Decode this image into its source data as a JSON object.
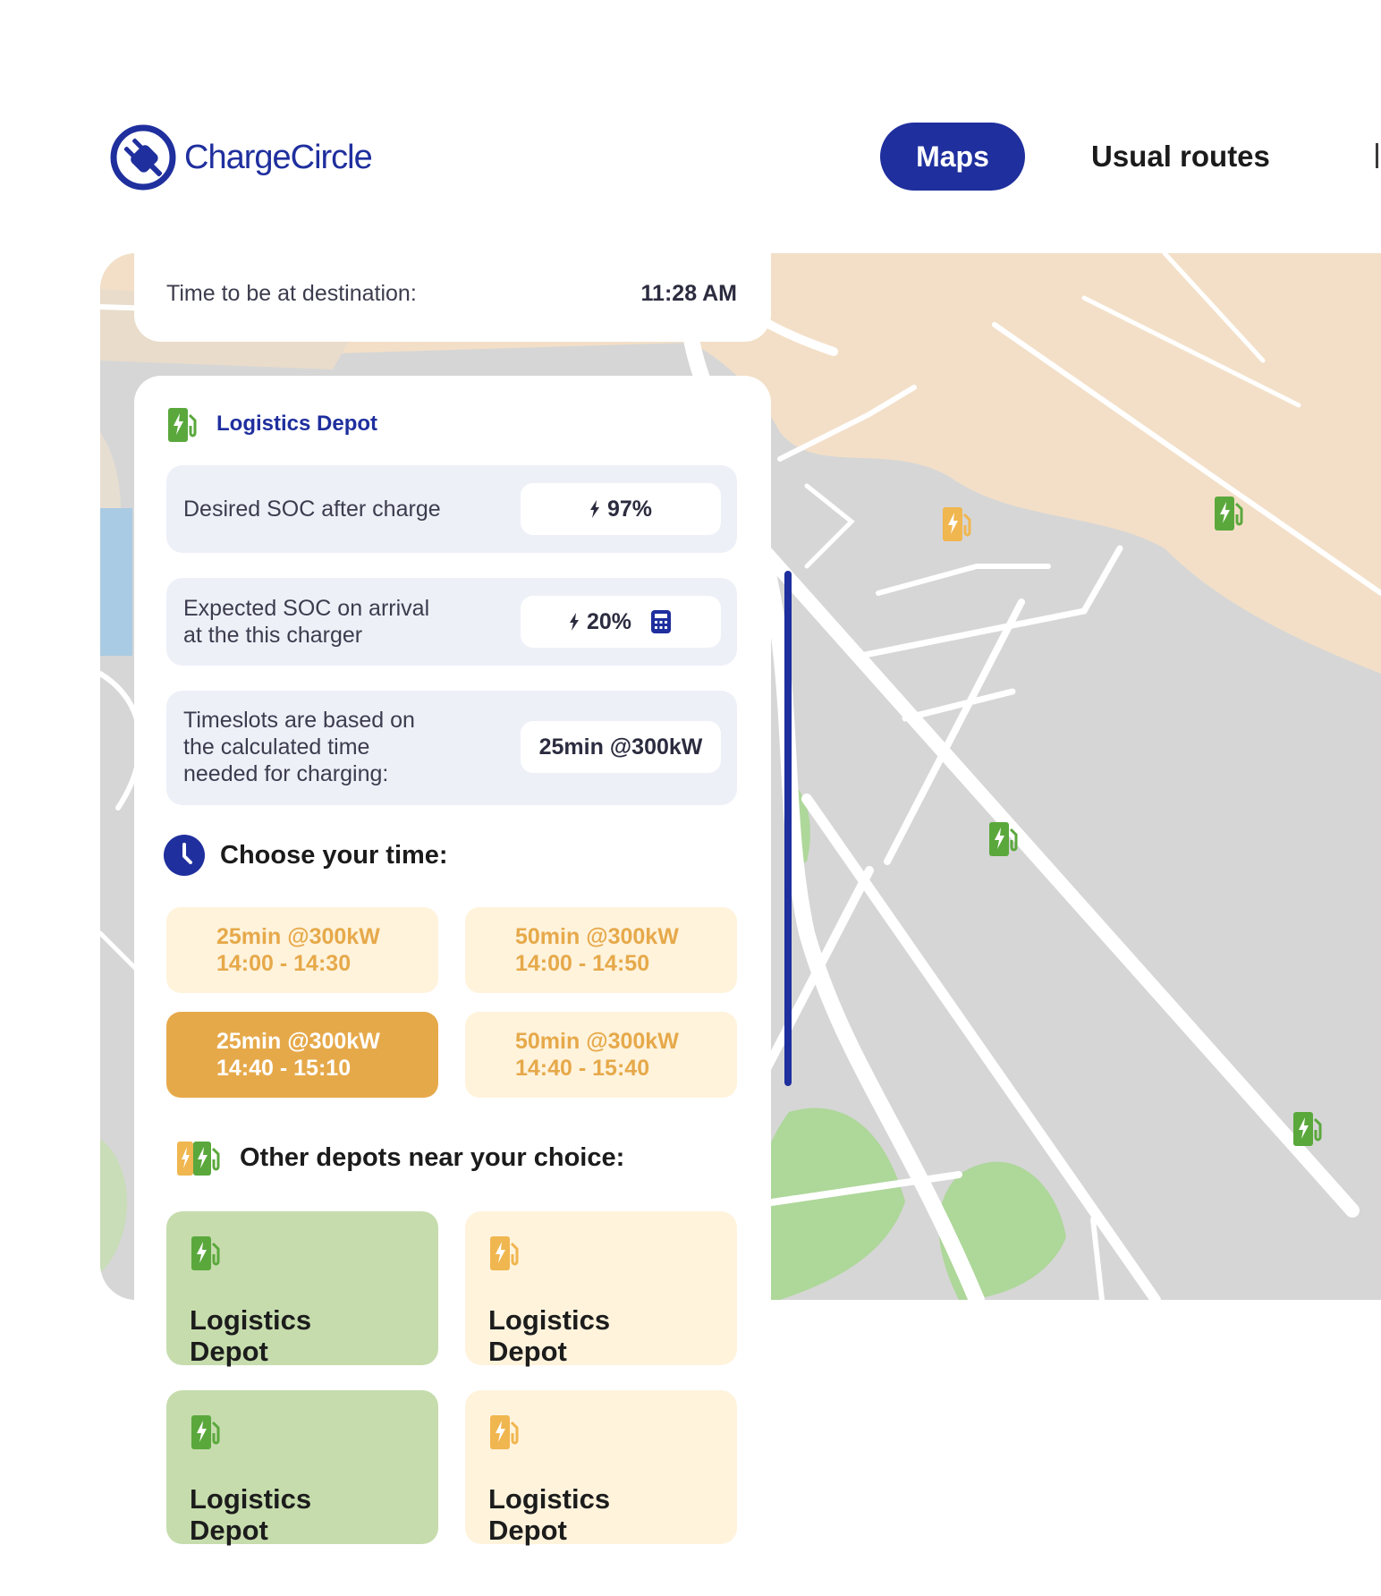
{
  "app": {
    "name": "ChargeCircle"
  },
  "nav": {
    "tabs": [
      {
        "label": "Maps",
        "active": true
      },
      {
        "label": "Usual routes",
        "active": false
      }
    ]
  },
  "destination": {
    "label": "Time to be at destination:",
    "value": "11:28 AM"
  },
  "depot": {
    "name": "Logistics Depot",
    "desired_soc": {
      "label": "Desired SOC after charge",
      "value": "97%"
    },
    "expected_soc": {
      "label_line1": "Expected SOC on arrival",
      "label_line2": "at the this charger",
      "value": "20%"
    },
    "timeslot_basis": {
      "label_line1": "Timeslots are based on",
      "label_line2": "the calculated time",
      "label_line3": "needed for charging:",
      "value": "25min @300kW"
    }
  },
  "choose_time": {
    "title": "Choose your time:",
    "slots": [
      {
        "line1": "25min @300kW",
        "line2": "14:00 - 14:30",
        "selected": false
      },
      {
        "line1": "50min @300kW",
        "line2": "14:00 - 14:50",
        "selected": false
      },
      {
        "line1": "25min @300kW",
        "line2": "14:40 - 15:10",
        "selected": true
      },
      {
        "line1": "50min @300kW",
        "line2": "14:40 - 15:40",
        "selected": false
      }
    ]
  },
  "other_depots": {
    "title": "Other depots near your choice:",
    "items": [
      {
        "line1": "Logistics",
        "line2": "Depot",
        "status": "available"
      },
      {
        "line1": "Logistics",
        "line2": "Depot",
        "status": "busy"
      },
      {
        "line1": "Logistics",
        "line2": "Depot",
        "status": "available"
      },
      {
        "line1": "Logistics",
        "line2": "Depot",
        "status": "busy"
      }
    ]
  },
  "icons": {
    "logo": "plug-circle-icon",
    "charger": "ev-charger-icon",
    "bolt": "bolt-icon",
    "calculator": "calculator-icon",
    "clock": "clock-icon"
  },
  "colors": {
    "brand": "#1f2f9e",
    "available": "#5aa83c",
    "busy": "#e6a94a",
    "slot_bg": "#fff3dc",
    "available_bg": "#c6dcad",
    "info_bg": "#eef0f8"
  }
}
